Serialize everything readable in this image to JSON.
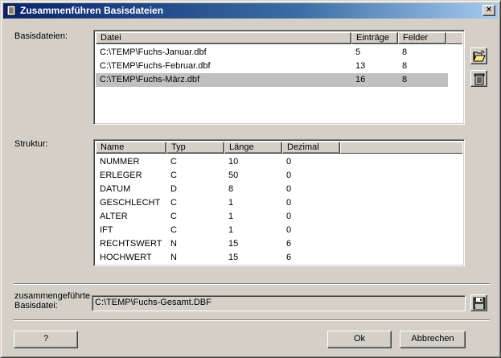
{
  "window": {
    "title": "Zusammenführen Basisdateien",
    "close_label": "×"
  },
  "basisdateien": {
    "label": "Basisdateien:",
    "columns": [
      "Datei",
      "Einträge",
      "Felder"
    ],
    "rows": [
      [
        "C:\\TEMP\\Fuchs-Januar.dbf",
        "5",
        "8"
      ],
      [
        "C:\\TEMP\\Fuchs-Februar.dbf",
        "13",
        "8"
      ],
      [
        "C:\\TEMP\\Fuchs-März.dbf",
        "16",
        "8"
      ]
    ],
    "selected_row": 2,
    "open_icon": "open-folder-icon",
    "delete_icon": "trash-icon"
  },
  "struktur": {
    "label": "Struktur:",
    "columns": [
      "Name",
      "Typ",
      "Länge",
      "Dezimal"
    ],
    "rows": [
      [
        "NUMMER",
        "C",
        "10",
        "0"
      ],
      [
        "ERLEGER",
        "C",
        "50",
        "0"
      ],
      [
        "DATUM",
        "D",
        "8",
        "0"
      ],
      [
        "GESCHLECHT",
        "C",
        "1",
        "0"
      ],
      [
        "ALTER",
        "C",
        "1",
        "0"
      ],
      [
        "IFT",
        "C",
        "1",
        "0"
      ],
      [
        "RECHTSWERT",
        "N",
        "15",
        "6"
      ],
      [
        "HOCHWERT",
        "N",
        "15",
        "6"
      ]
    ]
  },
  "ziel": {
    "label_line1": "zusammengeführte",
    "label_line2": "Basisdatei:",
    "path": "C:\\TEMP\\Fuchs-Gesamt.DBF",
    "save_icon": "floppy-disk-icon"
  },
  "buttons": {
    "help": "?",
    "ok": "Ok",
    "cancel": "Abbrechen"
  },
  "colors": {
    "face": "#d4d0c8",
    "title_start": "#0a246a",
    "title_end": "#a6caf0",
    "selection": "#c0c0c0"
  }
}
